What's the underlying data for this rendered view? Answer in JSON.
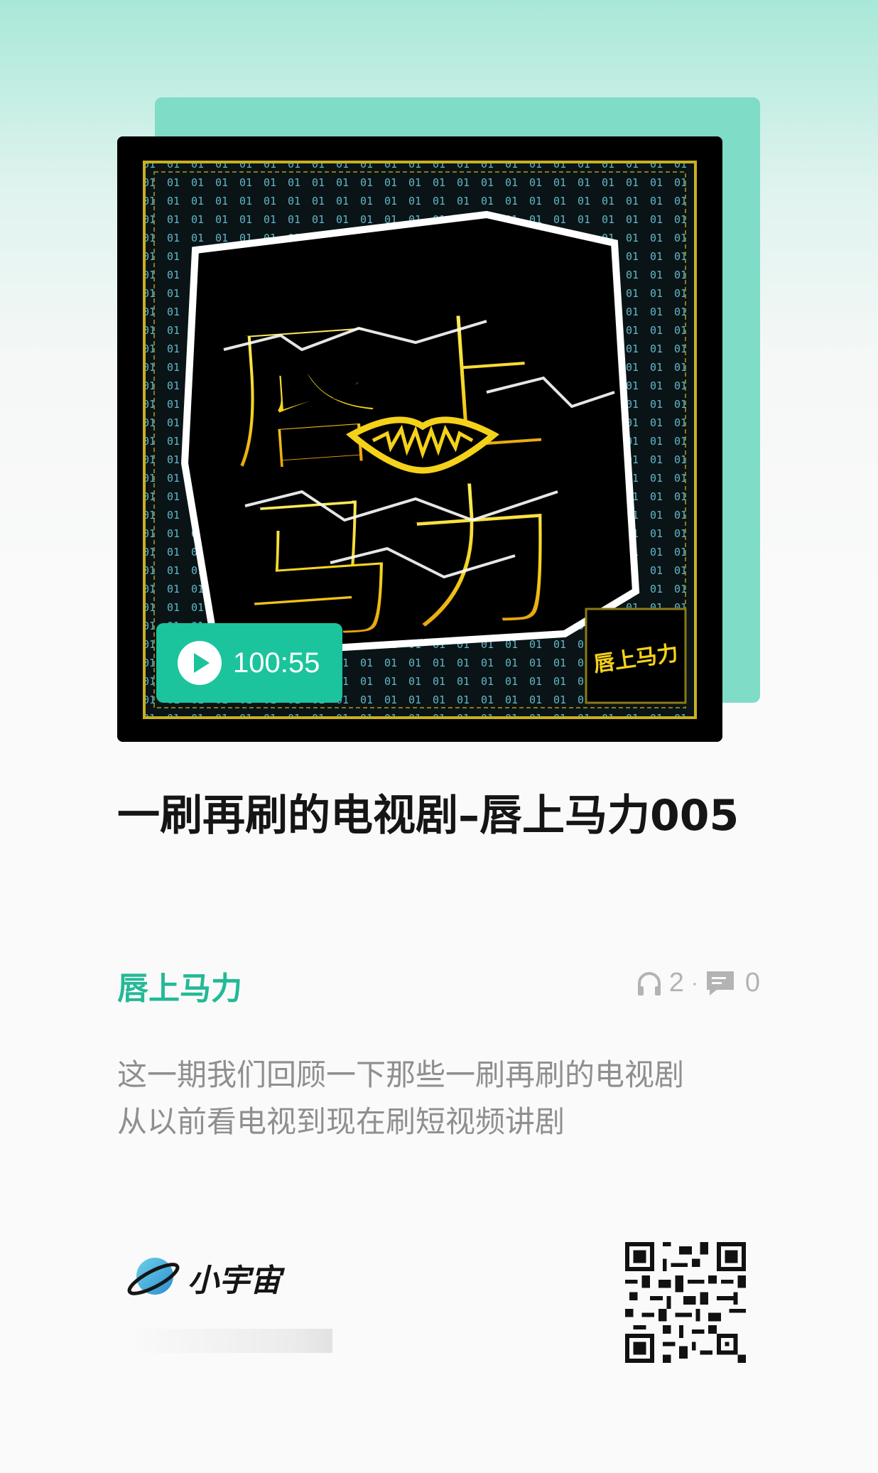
{
  "cover": {
    "art_text": [
      "唇上",
      "马力"
    ],
    "badge_text": "唇上马力",
    "duration": "100:55"
  },
  "episode": {
    "title": "一刷再刷的电视剧–唇上马力005",
    "podcast": "唇上马力",
    "listens": "2",
    "comments": "0",
    "description_lines": [
      "这一期我们回顾一下那些一刷再刷的电视剧",
      "从以前看电视到现在刷短视频讲剧"
    ]
  },
  "footer": {
    "brand_name": "小宇宙",
    "icons": [
      "planet-logo-icon",
      "qr-code-icon",
      "headphones-icon",
      "comment-icon",
      "play-icon"
    ]
  },
  "colors": {
    "accent": "#1bc49c",
    "card_back": "#7fdcc6",
    "art_yellow": "#f5d21a"
  }
}
